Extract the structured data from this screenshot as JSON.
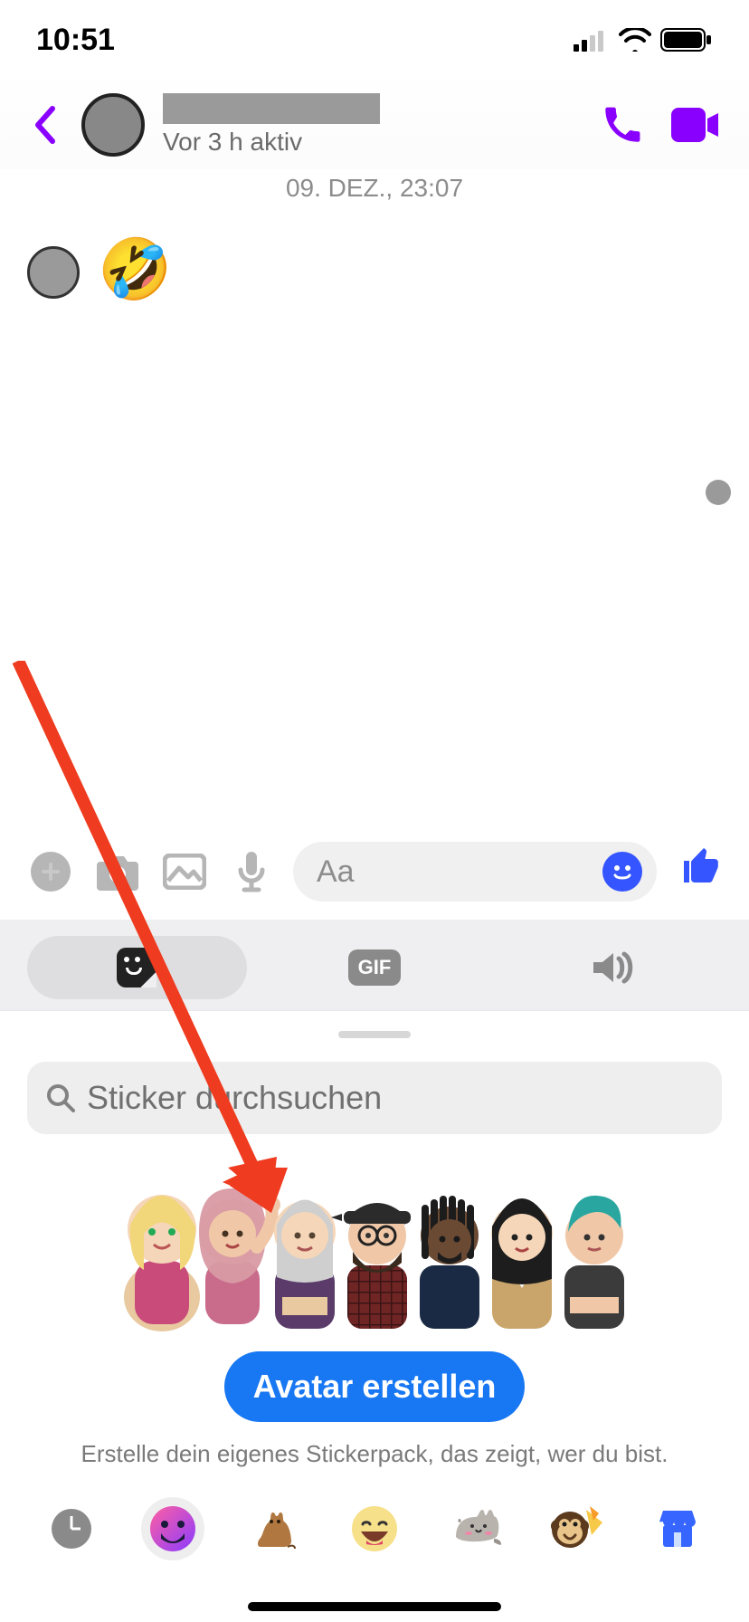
{
  "status": {
    "time": "10:51"
  },
  "header": {
    "activity": "Vor 3 h aktiv"
  },
  "chat": {
    "timestamp": "09. DEZ., 23:07",
    "received_emoji": "🤣"
  },
  "composer": {
    "placeholder": "Aa",
    "thumb": "👍"
  },
  "media_tabs": {
    "gif_label": "GIF"
  },
  "sticker_panel": {
    "search_placeholder": "Sticker durchsuchen",
    "button_label": "Avatar erstellen",
    "hint": "Erstelle dein eigenes Stickerpack, das zeigt, wer du bist."
  },
  "pack_strip": {
    "items": [
      "recent",
      "avatar",
      "cat",
      "smiley",
      "pusheen",
      "monkey",
      "store"
    ]
  }
}
